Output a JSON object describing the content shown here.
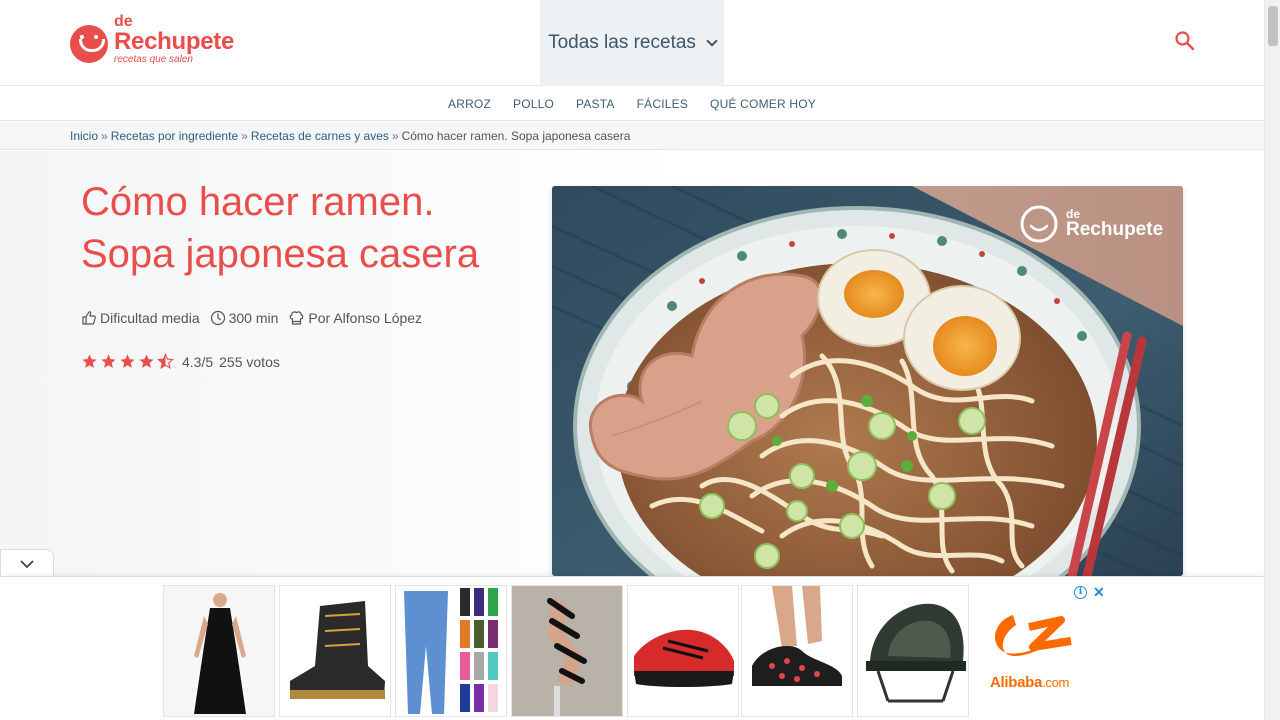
{
  "header": {
    "logo": {
      "prefix": "de",
      "name": "Rechupete",
      "tagline": "recetas que salen"
    },
    "all_recipes_label": "Todas las recetas"
  },
  "subnav": {
    "items": [
      {
        "label": "ARROZ"
      },
      {
        "label": "POLLO"
      },
      {
        "label": "PASTA"
      },
      {
        "label": "FÁCILES"
      },
      {
        "label": "QUÉ COMER HOY"
      }
    ]
  },
  "breadcrumb": {
    "items": [
      {
        "label": "Inicio"
      },
      {
        "label": "Recetas por ingrediente"
      },
      {
        "label": "Recetas de carnes y aves"
      }
    ],
    "separator": "»",
    "current": "Cómo hacer ramen. Sopa japonesa casera"
  },
  "recipe": {
    "title_line1": "Cómo hacer ramen.",
    "title_line2": "Sopa japonesa casera",
    "difficulty": "Dificultad media",
    "time": "300 min",
    "author": "Por Alfonso López",
    "rating": {
      "score": "4.3/5",
      "votes": "255 votos",
      "stars": 4.3
    },
    "photo_watermark_prefix": "de",
    "photo_watermark_name": "Rechupete"
  },
  "ad": {
    "brand": "Alibaba",
    "brand_suffix": ".com",
    "products": [
      "dress",
      "boot",
      "leggings",
      "sandal",
      "sneaker",
      "clog",
      "tent"
    ]
  },
  "colors": {
    "brand": "#e94e4b",
    "link": "#2e5f84",
    "nav": "#3d5f7a",
    "alibaba": "#ff6a00",
    "ad_info": "#1d8ad8"
  }
}
